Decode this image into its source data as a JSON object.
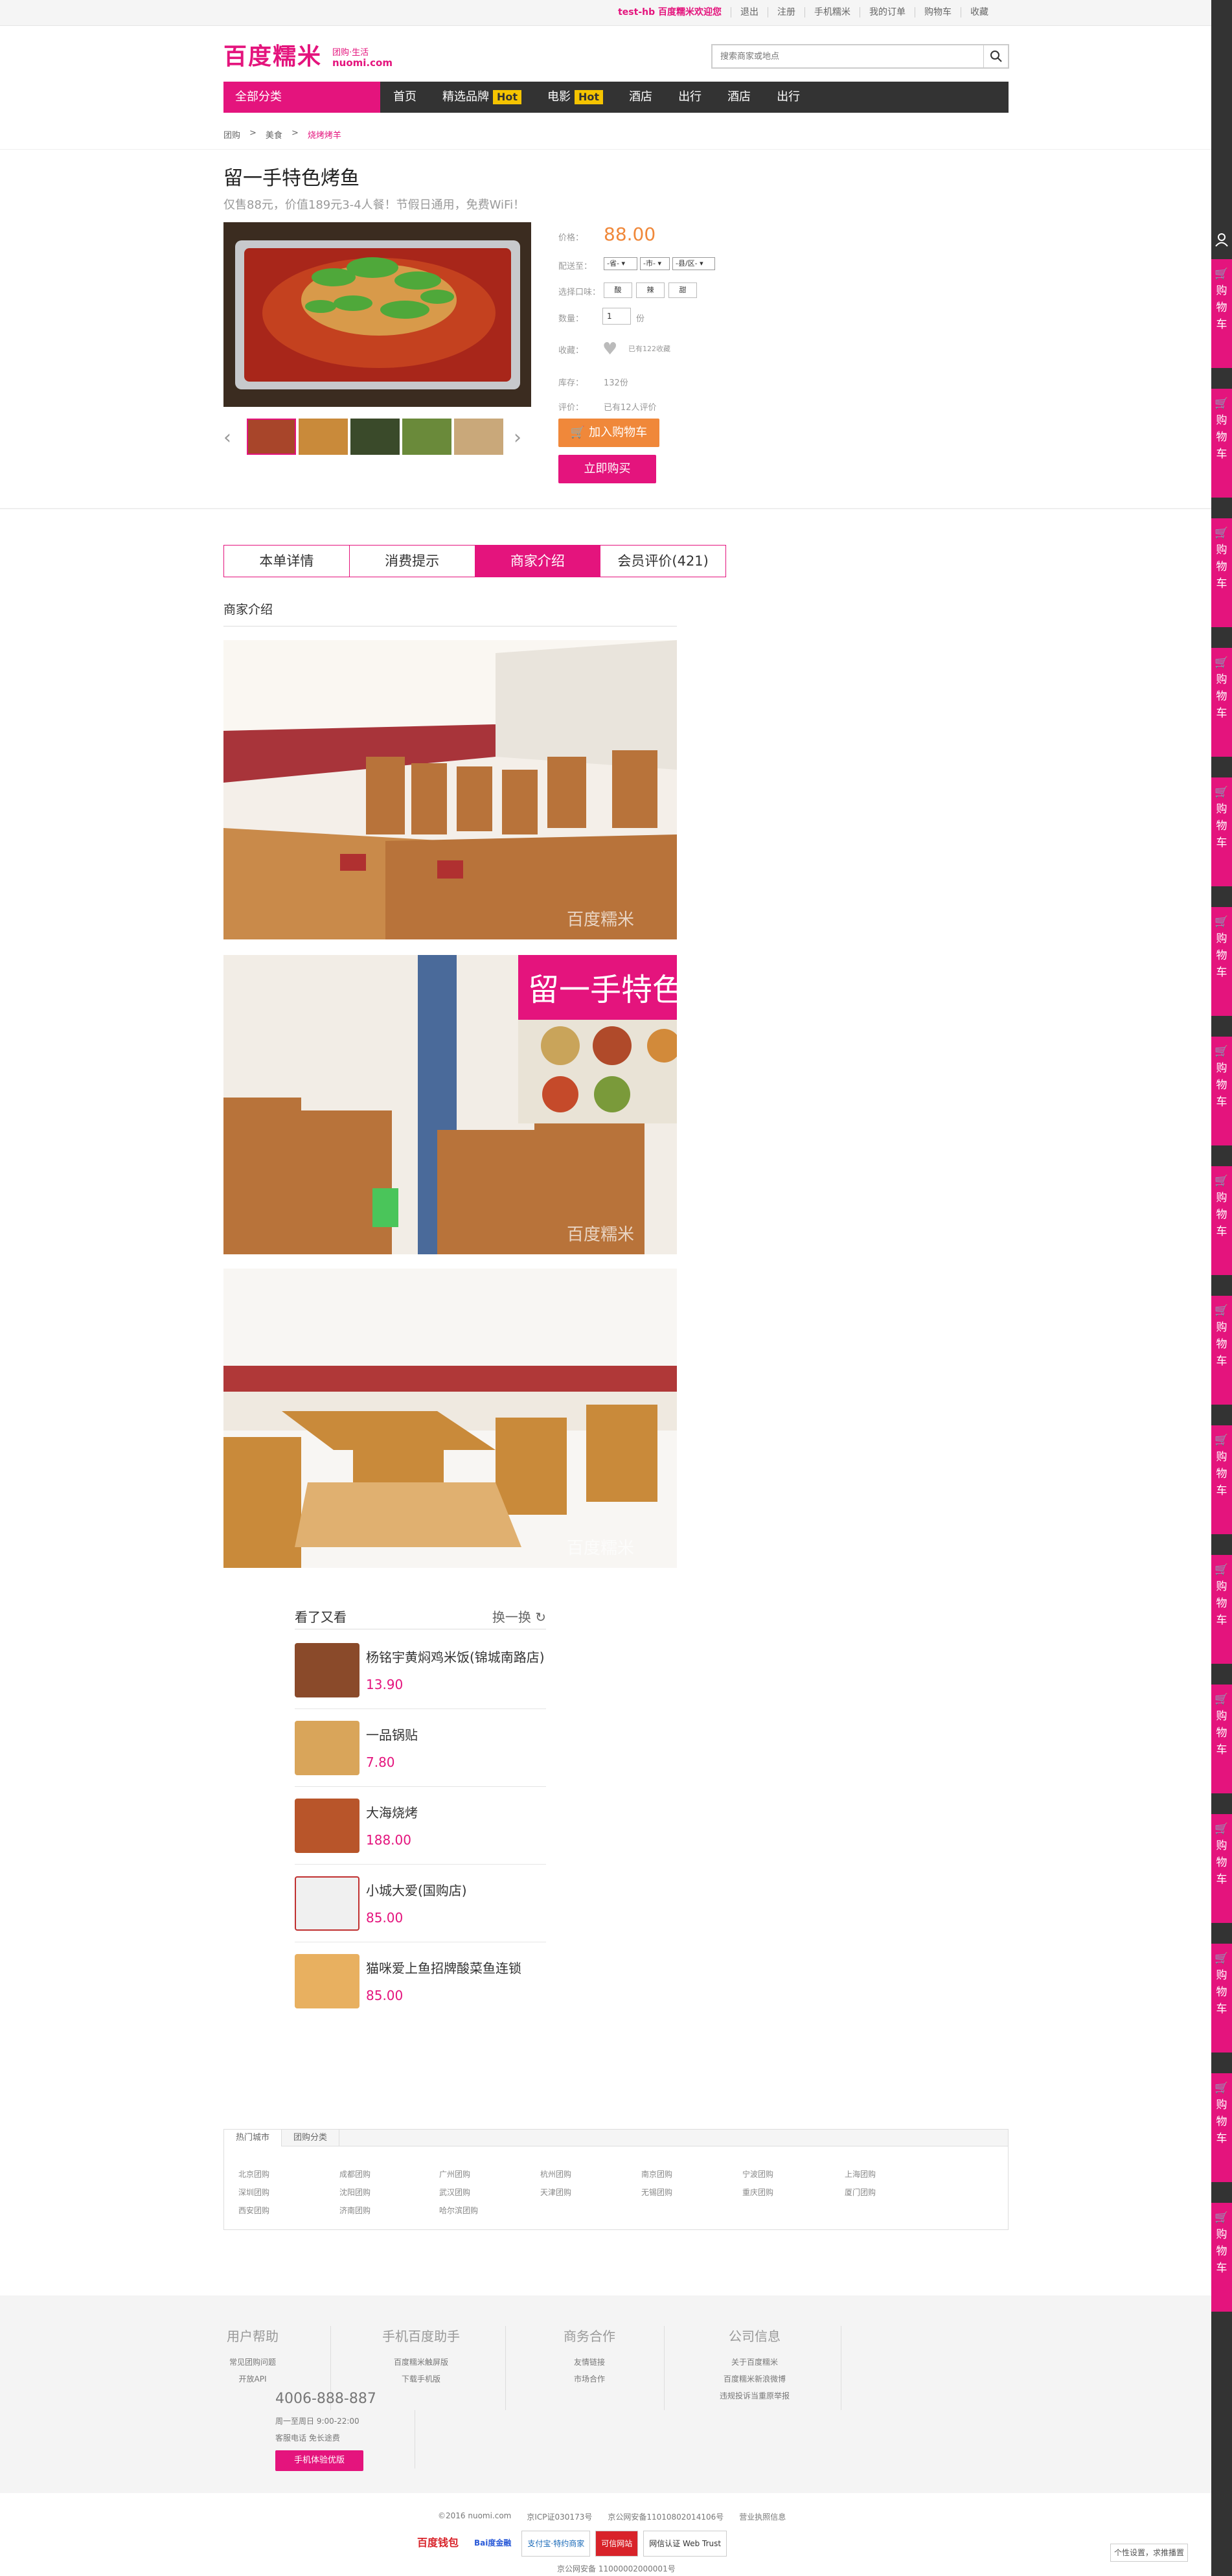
{
  "topbar": {
    "links": [
      "test-hb 百度糯米欢迎您",
      "退出",
      "注册",
      "手机糯米",
      "我的订单",
      "购物车",
      "收藏"
    ]
  },
  "header": {
    "logo_text": "百度糯米",
    "logo_sub": "团购·生活",
    "logo_en": "nuomi.com",
    "search_placeholder": "搜索商家或地点"
  },
  "nav": {
    "category": "全部分类",
    "items": [
      {
        "label": "首页",
        "hot": ""
      },
      {
        "label": "精选品牌",
        "hot": "Hot"
      },
      {
        "label": "电影",
        "hot": "Hot"
      },
      {
        "label": "酒店",
        "hot": ""
      },
      {
        "label": "出行",
        "hot": ""
      },
      {
        "label": "酒店",
        "hot": ""
      },
      {
        "label": "出行",
        "hot": ""
      }
    ]
  },
  "breadcrumb": [
    "团购",
    ">",
    "美食",
    ">",
    "烧烤烤羊"
  ],
  "deal": {
    "title": "留一手特色烤鱼",
    "subtitle": "仅售88元，价值189元3-4人餐！节假日通用，免费WiFi！",
    "price_label": "价格：",
    "price": "88.00",
    "delivery_label": "配送至：",
    "delivery": [
      "-省-",
      "-市-",
      "-县/区-"
    ],
    "flavor_label": "选择口味：",
    "flavors": [
      "酸",
      "辣",
      "甜"
    ],
    "qty_label": "数量：",
    "qty": "1",
    "qty_unit": "份",
    "fav_label": "收藏：",
    "fav_text": "已有122收藏",
    "stock_label": "库存：",
    "stock": "132份",
    "review_label": "评价：",
    "review": "已有12人评价",
    "add_cart": "加入购物车",
    "buy_now": "立即购买"
  },
  "tabs": [
    "本单详情",
    "消费提示",
    "商家介绍",
    "会员评价(421)"
  ],
  "active_tab": 2,
  "section_title": "商家介绍",
  "watermark": "百度糯米",
  "also": {
    "title": "看了又看",
    "more": "换一换",
    "items": [
      {
        "name": "杨铭宇黄焖鸡米饭(锦城南路店)",
        "price": "13.90"
      },
      {
        "name": "一品锅贴",
        "price": "7.80"
      },
      {
        "name": "大海烧烤",
        "price": "188.00"
      },
      {
        "name": "小城大爱(国购店)",
        "price": "85.00"
      },
      {
        "name": "猫咪爱上鱼招牌酸菜鱼连锁",
        "price": "85.00"
      }
    ]
  },
  "city": {
    "tabs": [
      "热门城市",
      "团购分类"
    ],
    "cities": [
      "北京团购",
      "成都团购",
      "广州团购",
      "杭州团购",
      "南京团购",
      "宁波团购",
      "上海团购",
      "深圳团购",
      "沈阳团购",
      "武汉团购",
      "天津团购",
      "无锡团购",
      "重庆团购",
      "厦门团购",
      "西安团购",
      "济南团购",
      "哈尔滨团购"
    ]
  },
  "footer": {
    "cols": [
      {
        "title": "用户帮助",
        "links": [
          "常见团购问题",
          "开放API"
        ]
      },
      {
        "title": "手机百度助手",
        "links": [
          "百度糯米触屏版",
          "下载手机版"
        ]
      },
      {
        "title": "商务合作",
        "links": [
          "友情链接",
          "市场合作"
        ]
      },
      {
        "title": "公司信息",
        "links": [
          "关于百度糯米",
          "百度糯米新浪微博",
          "违规投诉当重原举报"
        ]
      }
    ],
    "hotline": "4006-888-887",
    "hours": "周一至周日 9:00-22:00",
    "hotline_note": "客服电话 免长途费",
    "mobile_btn": "手机体验优版",
    "copyright": [
      "©2016 nuomi.com",
      "京ICP证030173号",
      "京公网安备11010802014106号",
      "营业执照信息"
    ],
    "badges": [
      "百度钱包",
      "Bai度金融",
      "支付宝·特约商家",
      "可信网站",
      "网信认证 Web Trust"
    ],
    "police": "京公网安备 11000002000001号",
    "settings": "个性设置，求推播置"
  },
  "sidebar": {
    "cart_label": "购物车",
    "cart_count": 16
  }
}
